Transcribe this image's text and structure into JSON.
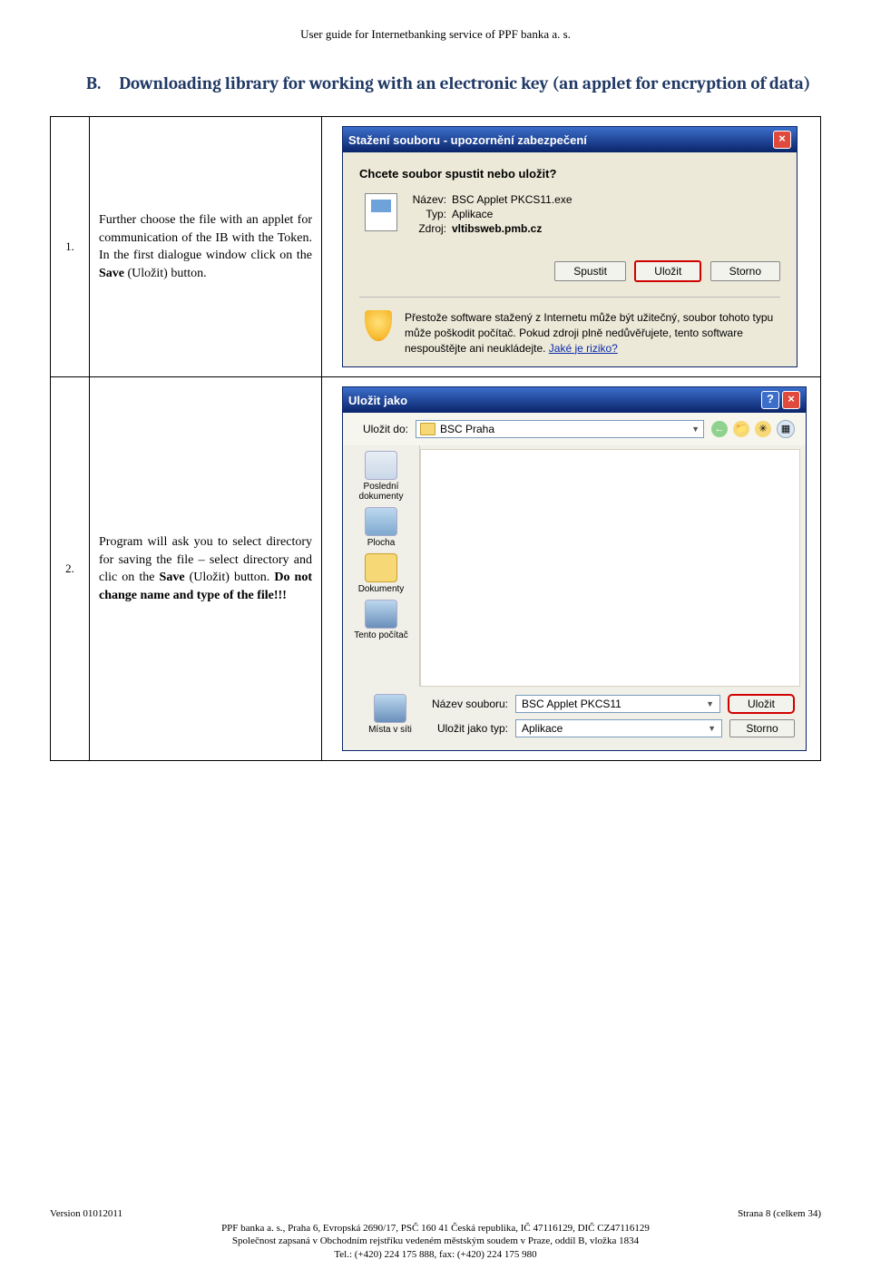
{
  "page_header": "User guide for Internetbanking service of PPF banka a. s.",
  "section": {
    "letter": "B.",
    "title": "Downloading library for working with an electronic key (an applet for encryption of data)"
  },
  "step1": {
    "num": "1.",
    "desc_before": "Further choose the file with an applet for communication of the IB with the Token. In the first dialogue window click on the ",
    "desc_save_word": "Save",
    "desc_after": " (Uložit) button."
  },
  "step2": {
    "num": "2.",
    "desc_before": "Program will ask you to select directory for saving the file – select directory and clic on the ",
    "desc_save_word": "Save",
    "desc_mid": " (Uložit) button. ",
    "desc_bold_tail": "Do not change name and type of the file!!!"
  },
  "dialog1": {
    "title": "Stažení souboru - upozornění zabezpečení",
    "question": "Chcete soubor spustit nebo uložit?",
    "rows": {
      "name_label": "Název:",
      "name_value": "BSC Applet PKCS11.exe",
      "type_label": "Typ:",
      "type_value": "Aplikace",
      "src_label": "Zdroj:",
      "src_value": "vltibsweb.pmb.cz"
    },
    "buttons": {
      "run": "Spustit",
      "save": "Uložit",
      "cancel": "Storno"
    },
    "warning_text": "Přestože software stažený z Internetu může být užitečný, soubor tohoto typu může poškodit počítač. Pokud zdroji plně nedůvěřujete, tento software nespouštějte ani neukládejte.",
    "warning_link": "Jaké je riziko?"
  },
  "dialog2": {
    "title": "Uložit jako",
    "savein_label": "Uložit do:",
    "savein_value": "BSC Praha",
    "places": {
      "recent": "Poslední dokumenty",
      "desktop": "Plocha",
      "docs": "Dokumenty",
      "computer": "Tento počítač",
      "network": "Místa v síti"
    },
    "filename_label": "Název souboru:",
    "filename_value": "BSC Applet PKCS11",
    "filetype_label": "Uložit jako typ:",
    "filetype_value": "Aplikace",
    "save_button": "Uložit",
    "cancel_button": "Storno"
  },
  "footer": {
    "version": "Version 01012011",
    "page": "Strana 8 (celkem 34)",
    "addr": "PPF banka a. s., Praha 6, Evropská 2690/17, PSČ 160 41 Česká republika, IČ 47116129, DIČ CZ47116129",
    "reg": "Společnost zapsaná v Obchodním rejstříku vedeném městským soudem v Praze, oddíl B, vložka 1834",
    "tel": "Tel.: (+420) 224 175 888, fax: (+420) 224 175 980"
  }
}
